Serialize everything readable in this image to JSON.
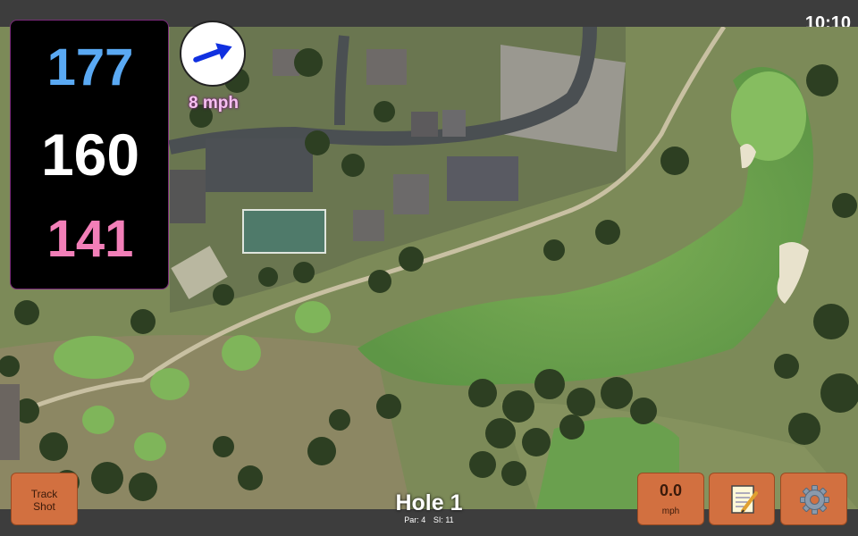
{
  "status_bar": {
    "time": "10:10"
  },
  "yardages": {
    "back": "177",
    "center": "160",
    "front": "141"
  },
  "wind": {
    "speed": "8 mph",
    "arrow_icon": "arrow-right-icon",
    "arrow_color": "#1030e0"
  },
  "buttons": {
    "track_shot": {
      "line1": "Track",
      "line2": "Shot"
    },
    "speed": {
      "value": "0.0",
      "unit": "mph"
    },
    "notes_icon": "notepad-icon",
    "settings_icon": "gear-icon"
  },
  "hole": {
    "title": "Hole 1",
    "par": "Par: 4",
    "si": "SI: 11"
  },
  "colors": {
    "back": "#5aa9f3",
    "center": "#ffffff",
    "front": "#f27fb8",
    "button": "#d27040"
  }
}
